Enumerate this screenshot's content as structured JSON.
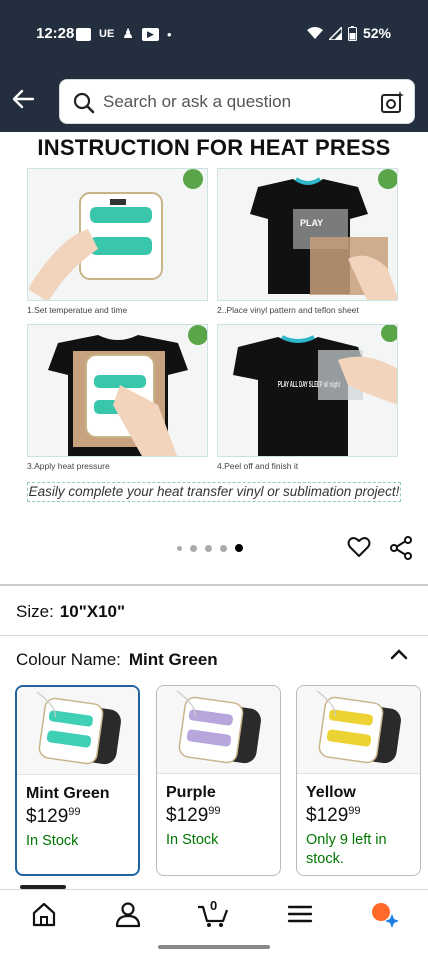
{
  "status": {
    "time": "12:28",
    "carrier_glyph": "UE",
    "battery": "52%"
  },
  "search": {
    "placeholder": "Search or ask a question"
  },
  "gallery": {
    "title": "INSTRUCTION FOR HEAT PRESS",
    "steps": [
      {
        "caption": "1.Set temperatue and time"
      },
      {
        "caption": "2..Place vinyl pattern and teflon sheet"
      },
      {
        "caption": "3.Apply heat pressure"
      },
      {
        "caption": "4.Peel off and finish it"
      }
    ],
    "promo": "Easily complete your heat transfer vinyl or sublimation project!",
    "shirt_text_1": "PLAY",
    "shirt_text_2": "PLAY ALL DAY SLEEP all night",
    "dots_total": 5,
    "dots_active_index": 4
  },
  "size": {
    "label": "Size:",
    "value": "10\"X10\""
  },
  "colour": {
    "label": "Colour Name:",
    "value": "Mint Green"
  },
  "swatches": [
    {
      "name": "Mint Green",
      "price_dollars": "$129",
      "price_cents": "99",
      "stock": "In Stock",
      "accent": "#3fcfb5",
      "selected": true
    },
    {
      "name": "Purple",
      "price_dollars": "$129",
      "price_cents": "99",
      "stock": "In Stock",
      "accent": "#b7a6dc",
      "selected": false
    },
    {
      "name": "Yellow",
      "price_dollars": "$129",
      "price_cents": "99",
      "stock": "Only 9 left in stock.",
      "accent": "#ecd232",
      "selected": false
    }
  ],
  "nav": {
    "cart_count": "0"
  },
  "colors": {
    "header_bg": "#232f3e",
    "in_stock_green": "#007600",
    "selected_border": "#2162a1"
  }
}
